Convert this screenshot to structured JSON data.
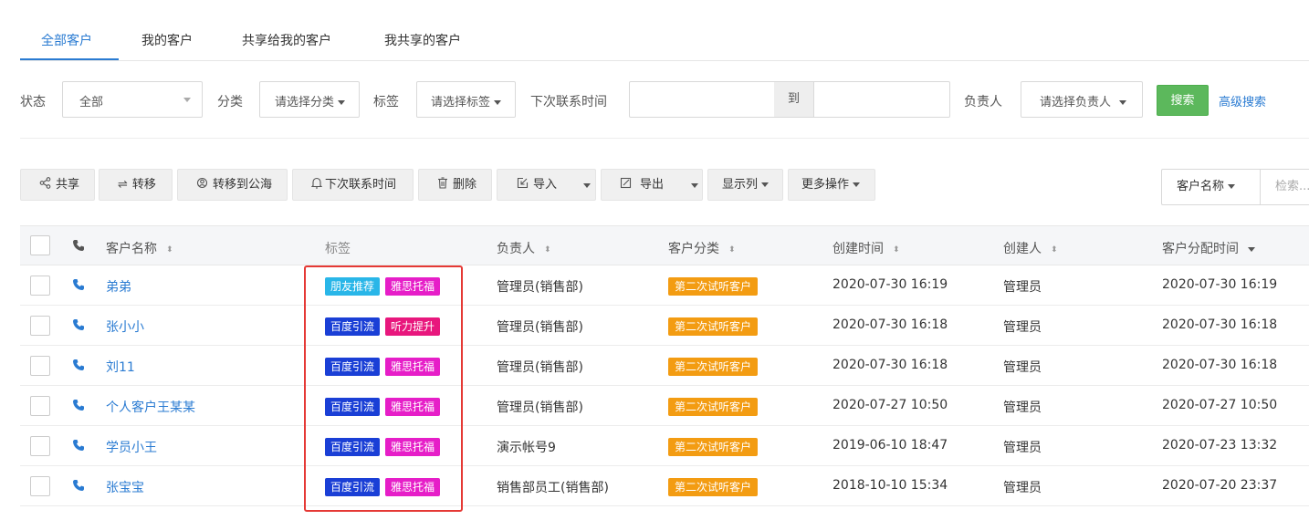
{
  "tabs": [
    {
      "label": "全部客户",
      "active": true
    },
    {
      "label": "我的客户",
      "active": false
    },
    {
      "label": "共享给我的客户",
      "active": false
    },
    {
      "label": "我共享的客户",
      "active": false
    }
  ],
  "filters": {
    "status_label": "状态",
    "status_value": "全部",
    "category_label": "分类",
    "category_placeholder": "请选择分类",
    "tag_label": "标签",
    "tag_placeholder": "请选择标签",
    "next_contact_label": "下次联系时间",
    "date_to": "到",
    "owner_label": "负责人",
    "owner_placeholder": "请选择负责人",
    "search_button": "搜索",
    "advanced_search": "高级搜索"
  },
  "toolbar": {
    "share": "共享",
    "transfer": "转移",
    "to_public": "转移到公海",
    "next_contact": "下次联系时间",
    "delete": "删除",
    "import": "导入",
    "export": "导出",
    "columns": "显示列",
    "more": "更多操作",
    "search_field": "客户名称",
    "search_placeholder": "检索..."
  },
  "table": {
    "headers": {
      "name": "客户名称",
      "tags": "标签",
      "owner": "负责人",
      "category": "客户分类",
      "created_at": "创建时间",
      "creator": "创建人",
      "assigned_at": "客户分配时间"
    },
    "rows": [
      {
        "name": "弟弟",
        "tag1": "朋友推荐",
        "tag2": "雅思托福",
        "owner": "管理员(销售部)",
        "category": "第二次试听客户",
        "created_at": "2020-07-30 16:19",
        "creator": "管理员",
        "assigned_at": "2020-07-30 16:19"
      },
      {
        "name": "张小小",
        "tag1": "百度引流",
        "tag2": "听力提升",
        "owner": "管理员(销售部)",
        "category": "第二次试听客户",
        "created_at": "2020-07-30 16:18",
        "creator": "管理员",
        "assigned_at": "2020-07-30 16:18"
      },
      {
        "name": "刘11",
        "tag1": "百度引流",
        "tag2": "雅思托福",
        "owner": "管理员(销售部)",
        "category": "第二次试听客户",
        "created_at": "2020-07-30 16:18",
        "creator": "管理员",
        "assigned_at": "2020-07-30 16:18"
      },
      {
        "name": "个人客户王某某",
        "tag1": "百度引流",
        "tag2": "雅思托福",
        "owner": "管理员(销售部)",
        "category": "第二次试听客户",
        "created_at": "2020-07-27 10:50",
        "creator": "管理员",
        "assigned_at": "2020-07-27 10:50"
      },
      {
        "name": "学员小王",
        "tag1": "百度引流",
        "tag2": "雅思托福",
        "owner": "演示帐号9",
        "category": "第二次试听客户",
        "created_at": "2019-06-10 18:47",
        "creator": "管理员",
        "assigned_at": "2020-07-23 13:32"
      },
      {
        "name": "张宝宝",
        "tag1": "百度引流",
        "tag2": "雅思托福",
        "owner": "销售部员工(销售部)",
        "category": "第二次试听客户",
        "created_at": "2018-10-10 15:34",
        "creator": "管理员",
        "assigned_at": "2020-07-20 23:37"
      }
    ]
  },
  "colors": {
    "accent": "#2a7bd2",
    "search_green": "#5cb85c",
    "tag_friend": "#29b6e8",
    "tag_baidu": "#1a3fd6",
    "tag_ielts": "#e61ec8",
    "tag_listening": "#e8177d",
    "category_orange": "#f39c12",
    "highlight_red": "#e53935"
  },
  "tag_color_map": {
    "朋友推荐": "tag_friend",
    "百度引流": "tag_baidu",
    "雅思托福": "tag_ielts",
    "听力提升": "tag_listening"
  }
}
